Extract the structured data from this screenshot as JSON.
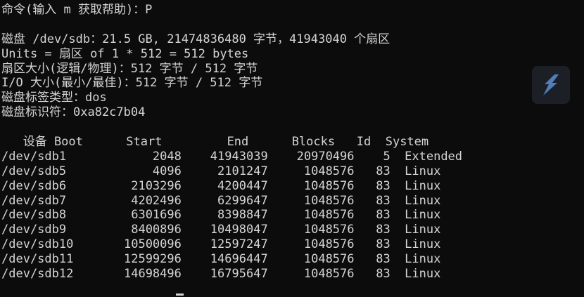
{
  "terminal": {
    "lines": [
      "命令(输入 m 获取帮助)：P",
      "",
      "磁盘 /dev/sdb：21.5 GB, 21474836480 字节，41943040 个扇区",
      "Units = 扇区 of 1 * 512 = 512 bytes",
      "扇区大小(逻辑/物理)：512 字节 / 512 字节",
      "I/O 大小(最小/最佳)：512 字节 / 512 字节",
      "磁盘标签类型：dos",
      "磁盘标识符：0xa82c7b04",
      "",
      "   设备 Boot      Start         End      Blocks   Id  System",
      "/dev/sdb1            2048    41943039    20970496    5  Extended",
      "/dev/sdb5            4096     2101247     1048576   83  Linux",
      "/dev/sdb6         2103296     4200447     1048576   83  Linux",
      "/dev/sdb7         4202496     6299647     1048576   83  Linux",
      "/dev/sdb8         6301696     8398847     1048576   83  Linux",
      "/dev/sdb9         8400896    10498047     1048576   83  Linux",
      "/dev/sdb10       10500096    12597247     1048576   83  Linux",
      "/dev/sdb11       12599296    14696447     1048576   83  Linux",
      "/dev/sdb12       14698496    16795647     1048576   83  Linux"
    ]
  },
  "colors": {
    "background": "#0c0c0c",
    "text": "#d4d4d4",
    "badge_bg": "#1c1f26",
    "badge_icon": "#5b8fd6"
  },
  "icons": {
    "overlay": "app-logo-icon"
  }
}
